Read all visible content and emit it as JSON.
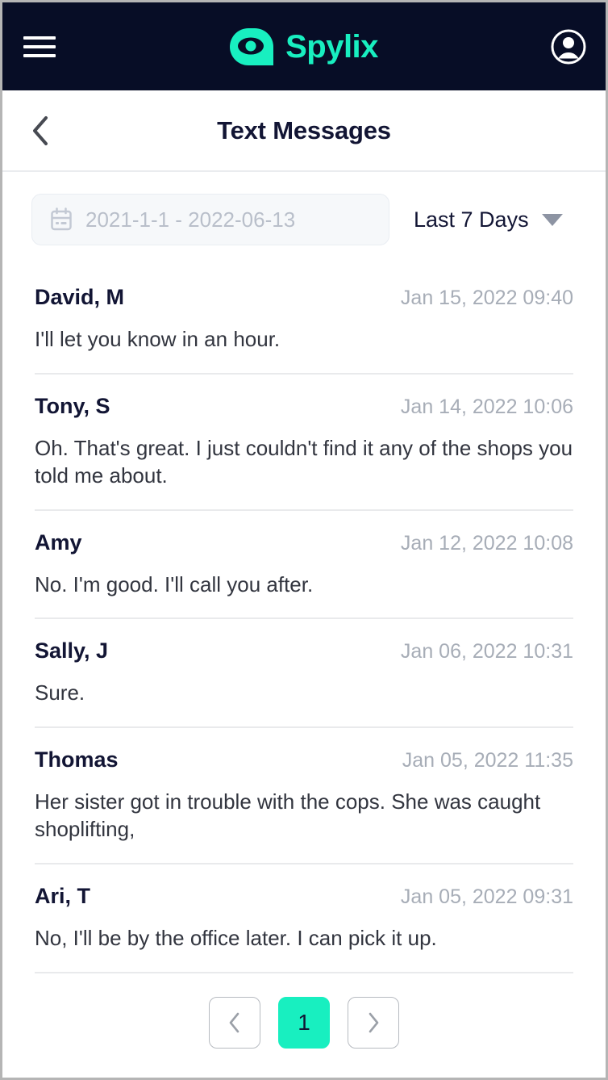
{
  "header": {
    "menu_icon": "hamburger-menu-icon",
    "brand_name": "Spylix",
    "brand_mark_icon": "spylix-eye-logo-icon",
    "account_icon": "user-account-icon",
    "background_color": "#070d26",
    "accent_color": "#18EFC0"
  },
  "titlebar": {
    "back_icon": "chevron-left-icon",
    "title": "Text Messages"
  },
  "filters": {
    "date_range": {
      "icon": "calendar-icon",
      "value": "2021-1-1 - 2022-06-13",
      "placeholder": "2021-1-1 - 2022-06-13"
    },
    "range_preset": {
      "label": "Last 7 Days",
      "caret_icon": "chevron-down-icon"
    }
  },
  "messages": [
    {
      "sender": "David, M",
      "time": "Jan 15, 2022 09:40",
      "text": "I'll let you know in an hour."
    },
    {
      "sender": "Tony, S",
      "time": "Jan 14, 2022 10:06",
      "text": "Oh. That's great. I just couldn't find it any of the shops you told me about."
    },
    {
      "sender": "Amy",
      "time": "Jan 12, 2022 10:08",
      "text": "No. I'm good. I'll call you after."
    },
    {
      "sender": "Sally, J",
      "time": "Jan 06, 2022 10:31",
      "text": "Sure."
    },
    {
      "sender": "Thomas",
      "time": "Jan 05, 2022 11:35",
      "text": "Her sister got in trouble with the cops. She was caught shoplifting,"
    },
    {
      "sender": "Ari, T",
      "time": "Jan 05, 2022 09:31",
      "text": "No, I'll be by the office later. I can pick it up."
    }
  ],
  "pagination": {
    "prev_icon": "chevron-left-icon",
    "next_icon": "chevron-right-icon",
    "current_page": "1"
  }
}
